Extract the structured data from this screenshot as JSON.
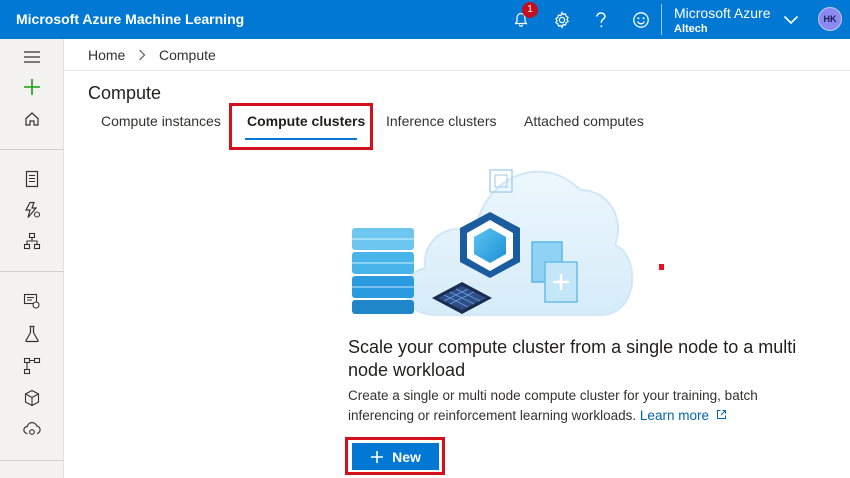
{
  "header": {
    "brand": "Microsoft Azure Machine Learning",
    "notification_count": "1",
    "account_name": "Microsoft Azure",
    "account_org": "Altech",
    "avatar_initials": "HK"
  },
  "breadcrumb": {
    "home": "Home",
    "current": "Compute"
  },
  "page": {
    "title": "Compute",
    "tabs": [
      {
        "label": "Compute instances",
        "active": false
      },
      {
        "label": "Compute clusters",
        "active": true
      },
      {
        "label": "Inference clusters",
        "active": false
      },
      {
        "label": "Attached computes",
        "active": false
      }
    ]
  },
  "empty_state": {
    "title": "Scale your compute cluster from a single node to a multi node workload",
    "description": "Create a single or multi node compute cluster for your training, batch inferencing or reinforcement learning workloads.",
    "learn_more": "Learn more",
    "new_button": "New"
  },
  "colors": {
    "brand_blue": "#0078d4",
    "highlight_red": "#d40f1e"
  },
  "icons": {
    "rail": [
      "hamburger-icon",
      "plus-icon",
      "home-icon",
      "notebook-icon",
      "automl-icon",
      "designer-icon",
      "datasets-icon",
      "experiments-icon",
      "pipelines-icon",
      "models-icon",
      "endpoints-icon"
    ],
    "top": [
      "bell-icon",
      "gear-icon",
      "help-icon",
      "smiley-icon",
      "chevron-down-icon"
    ]
  }
}
